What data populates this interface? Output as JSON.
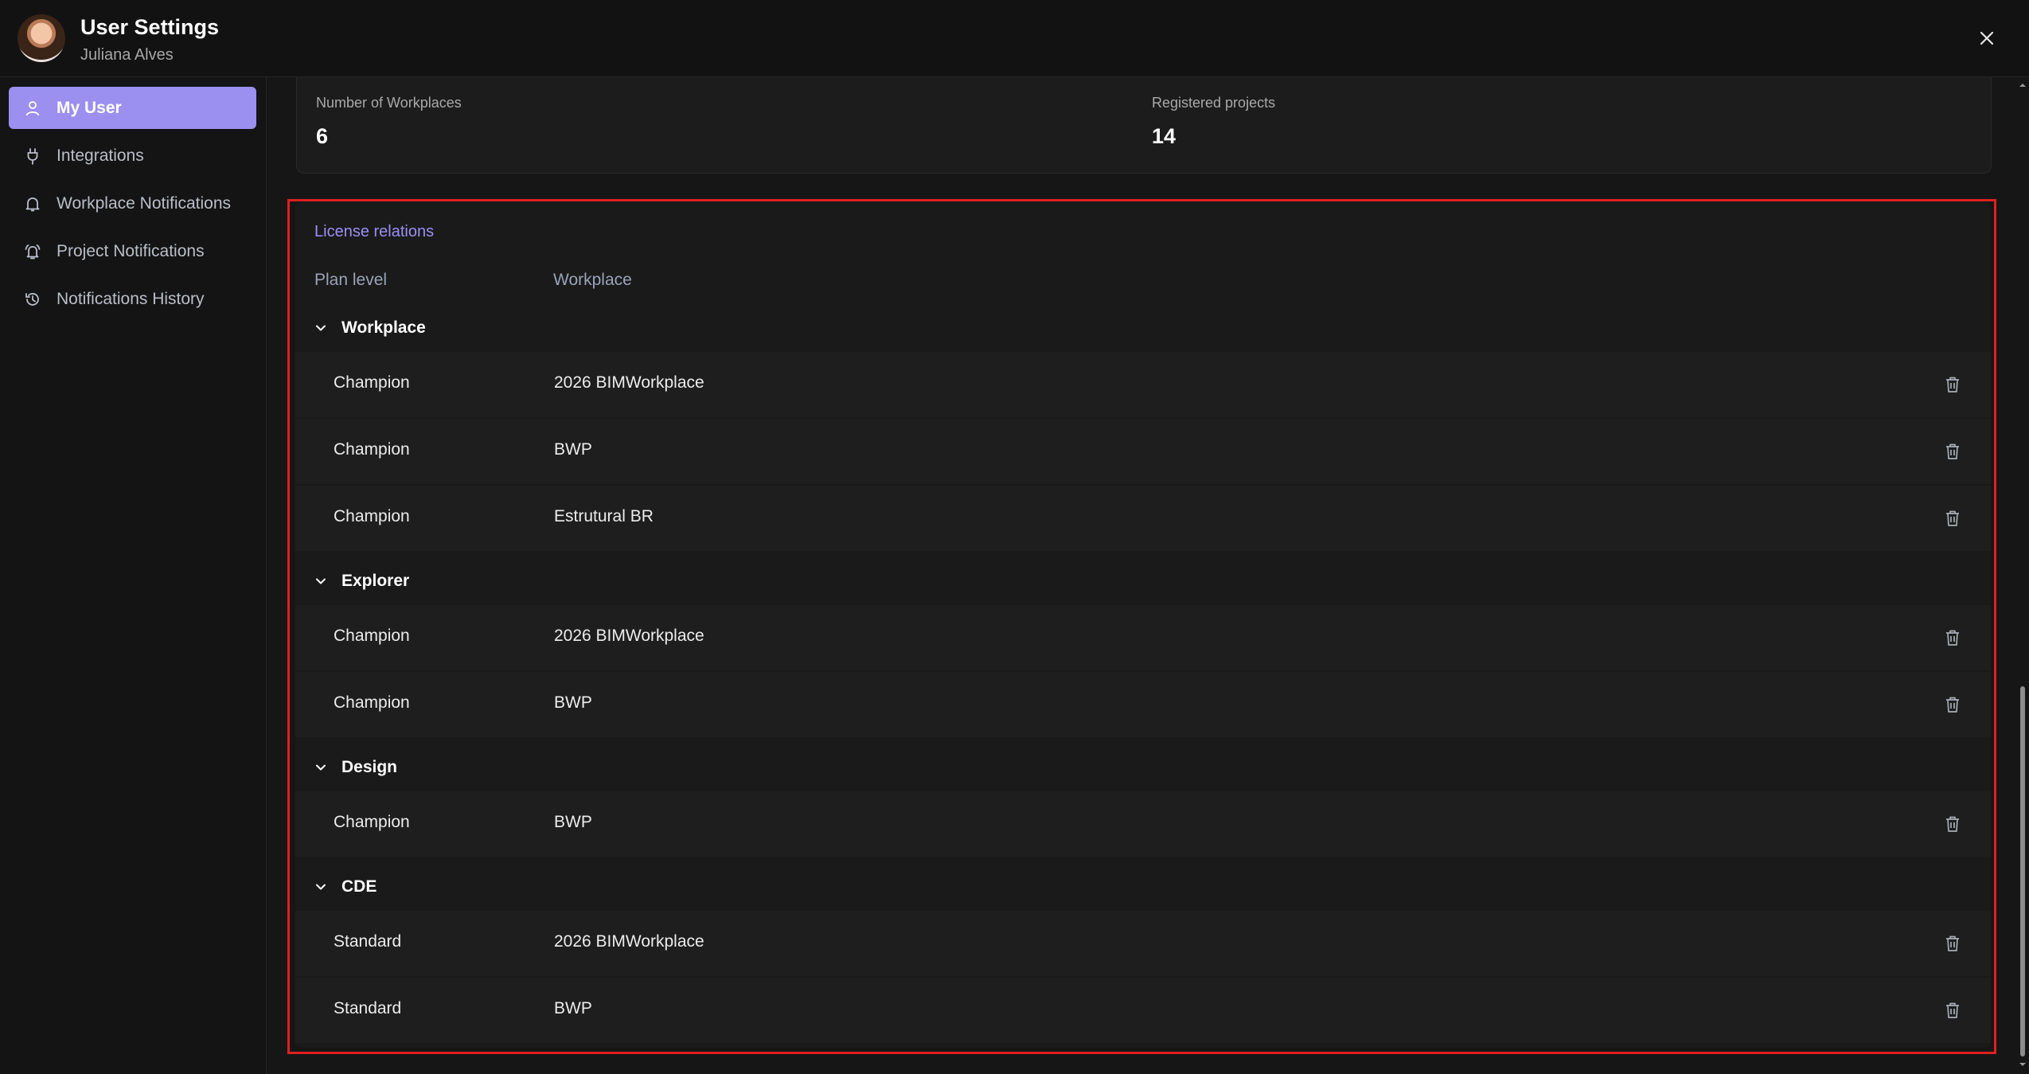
{
  "window": {
    "title": "User Settings",
    "user_name": "Juliana Alves",
    "close_icon": "close-icon"
  },
  "sidebar": {
    "items": [
      {
        "label": "My User",
        "icon": "user-icon",
        "active": true
      },
      {
        "label": "Integrations",
        "icon": "plug-icon",
        "active": false
      },
      {
        "label": "Workplace Notifications",
        "icon": "bell-icon",
        "active": false
      },
      {
        "label": "Project Notifications",
        "icon": "bell-ring-icon",
        "active": false
      },
      {
        "label": "Notifications History",
        "icon": "history-icon",
        "active": false
      }
    ]
  },
  "stats": {
    "workplaces_label": "Number of Workplaces",
    "workplaces_value": "6",
    "projects_label": "Registered projects",
    "projects_value": "14"
  },
  "license": {
    "title": "License relations",
    "columns": {
      "plan": "Plan level",
      "workplace": "Workplace"
    },
    "groups": [
      {
        "name": "Workplace",
        "rows": [
          {
            "plan": "Champion",
            "workplace": "2026 BIMWorkplace"
          },
          {
            "plan": "Champion",
            "workplace": "BWP"
          },
          {
            "plan": "Champion",
            "workplace": "Estrutural BR"
          }
        ]
      },
      {
        "name": "Explorer",
        "rows": [
          {
            "plan": "Champion",
            "workplace": "2026 BIMWorkplace"
          },
          {
            "plan": "Champion",
            "workplace": "BWP"
          }
        ]
      },
      {
        "name": "Design",
        "rows": [
          {
            "plan": "Champion",
            "workplace": "BWP"
          }
        ]
      },
      {
        "name": "CDE",
        "rows": [
          {
            "plan": "Standard",
            "workplace": "2026 BIMWorkplace"
          },
          {
            "plan": "Standard",
            "workplace": "BWP"
          }
        ]
      }
    ]
  },
  "colors": {
    "accent": "#9b8ff0",
    "highlight_border": "#e02020",
    "background": "#161616"
  }
}
